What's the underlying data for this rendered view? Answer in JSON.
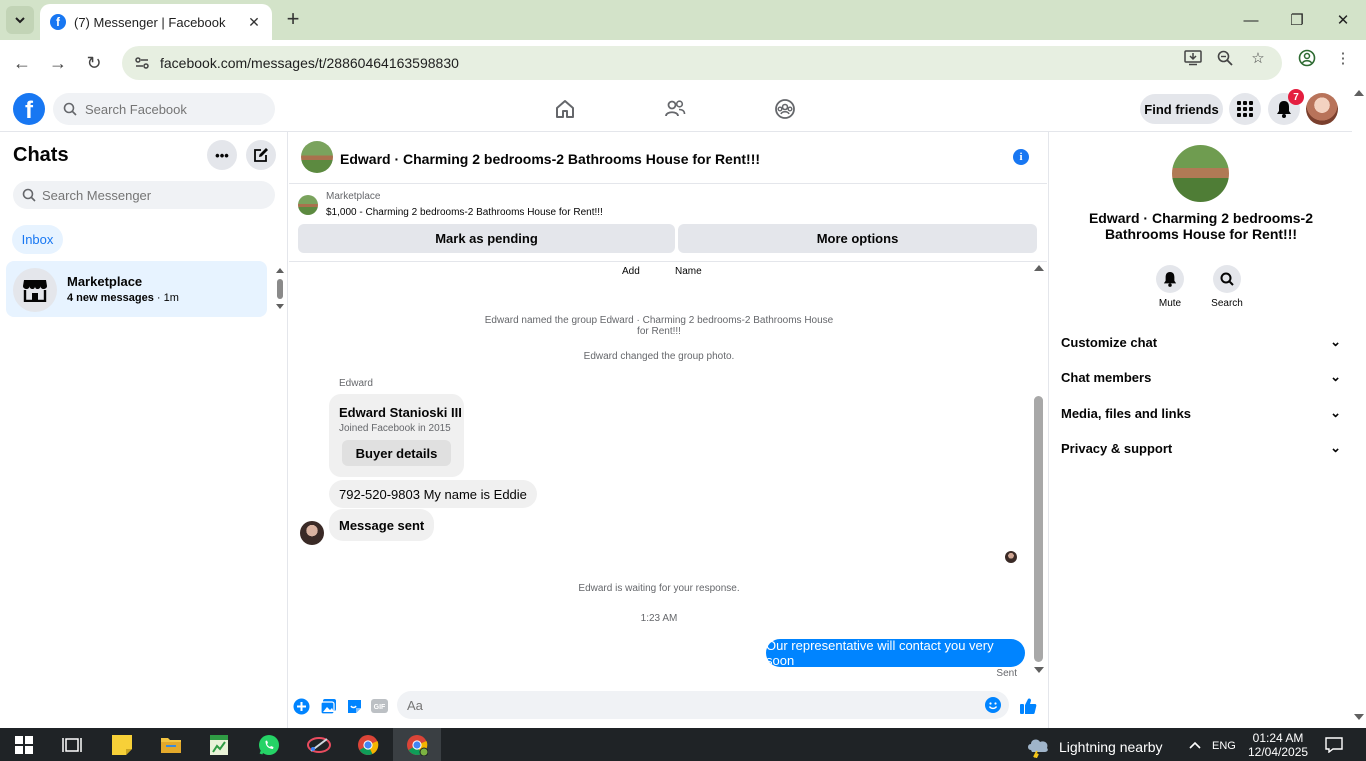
{
  "browser": {
    "tab_title": "(7) Messenger | Facebook",
    "url": "facebook.com/messages/t/28860464163598830"
  },
  "fb_nav": {
    "search_placeholder": "Search Facebook",
    "find_friends": "Find friends",
    "notifications_count": "7"
  },
  "sidebar": {
    "title": "Chats",
    "search_placeholder": "Search Messenger",
    "filter_inbox": "Inbox",
    "conversations": [
      {
        "name": "Marketplace",
        "preview_bold": "4 new messages",
        "time": " · 1m"
      }
    ]
  },
  "conversation": {
    "title": "Edward · Charming 2 bedrooms-2 Bathrooms House for Rent!!!",
    "marketplace_label": "Marketplace",
    "listing": "$1,000 - Charming 2 bedrooms-2 Bathrooms House for Rent!!!",
    "mark_pending": "Mark as pending",
    "more_options": "More options",
    "top_actions": [
      "Add",
      "Name"
    ],
    "system_rename": "Edward named the group Edward · Charming 2 bedrooms-2 Bathrooms House for Rent!!!",
    "system_photo": "Edward changed the group photo.",
    "sender": "Edward",
    "buyer_card": {
      "name": "Edward Stanioski III",
      "joined": "Joined Facebook in 2015",
      "button": "Buyer details"
    },
    "msg_phone": "792-520-9803 My name is Eddie",
    "msg_sent": "Message sent",
    "waiting": "Edward is waiting for your response.",
    "timestamp": "1:23 AM",
    "outgoing": "Our representative will contact you very soon",
    "status": "Sent",
    "composer_placeholder": "Aa"
  },
  "details": {
    "title": "Edward · Charming 2 bedrooms-2 Bathrooms House for Rent!!!",
    "actions": [
      "Mute",
      "Search"
    ],
    "sections": [
      "Customize chat",
      "Chat members",
      "Media, files and links",
      "Privacy & support"
    ]
  },
  "taskbar": {
    "weather": "Lightning nearby",
    "lang": "ENG",
    "time": "01:24 AM",
    "date": "12/04/2025"
  },
  "colors": {
    "fb_blue": "#1877f2",
    "messenger_blue": "#0084ff",
    "chrome_frame": "#d3e3c9",
    "notification_red": "#e41e3f"
  }
}
